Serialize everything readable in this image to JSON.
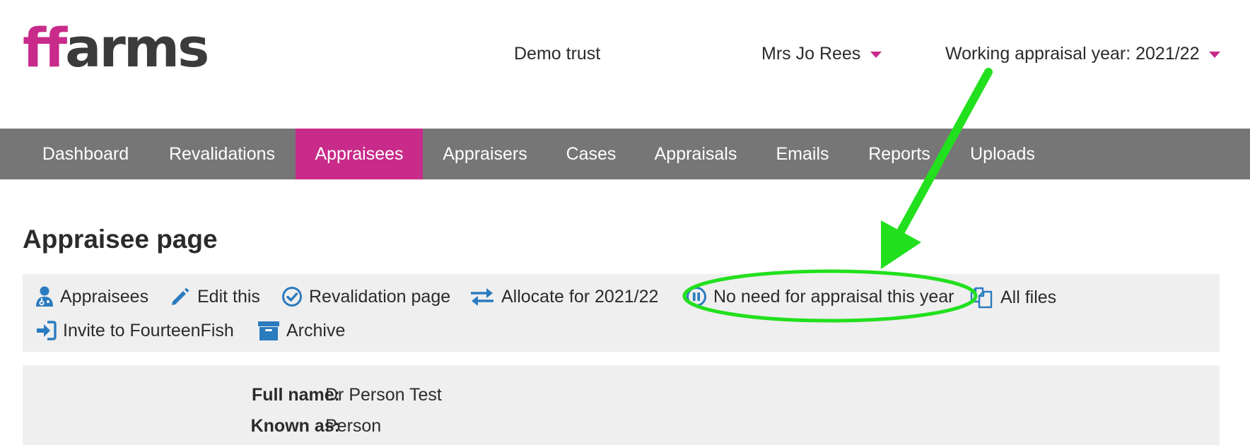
{
  "header": {
    "logo_ff": "ff",
    "logo_rest": "arms",
    "trust": "Demo trust",
    "user": "Mrs Jo Rees",
    "working_year": "Working appraisal year: 2021/22"
  },
  "nav": {
    "items": [
      {
        "label": "Dashboard"
      },
      {
        "label": "Revalidations"
      },
      {
        "label": "Appraisees",
        "active": true
      },
      {
        "label": "Appraisers"
      },
      {
        "label": "Cases"
      },
      {
        "label": "Appraisals"
      },
      {
        "label": "Emails"
      },
      {
        "label": "Reports"
      },
      {
        "label": "Uploads"
      }
    ]
  },
  "page": {
    "title": "Appraisee page"
  },
  "actions": {
    "appraisees": {
      "label": "Appraisees",
      "icon": "user-doctor-icon"
    },
    "edit": {
      "label": "Edit this",
      "icon": "pencil-icon"
    },
    "revalidation": {
      "label": "Revalidation page",
      "icon": "check-circle-icon"
    },
    "allocate": {
      "label": "Allocate for 2021/22",
      "icon": "exchange-arrows-icon"
    },
    "no_need": {
      "label": "No need for appraisal this year",
      "icon": "pause-circle-icon"
    },
    "all_files": {
      "label": "All files",
      "icon": "files-icon"
    },
    "invite": {
      "label": "Invite to FourteenFish",
      "icon": "sign-in-icon"
    },
    "archive": {
      "label": "Archive",
      "icon": "archive-box-icon"
    }
  },
  "details": {
    "full_name_label": "Full name:",
    "full_name": "Dr Person Test",
    "known_as_label": "Known as:",
    "known_as": "Person"
  },
  "colors": {
    "brand_pink": "#c82b8a",
    "nav_gray": "#767676",
    "icon_blue": "#2b7bbf",
    "annotation_green": "#22e01e",
    "panel_gray": "#efefef"
  }
}
